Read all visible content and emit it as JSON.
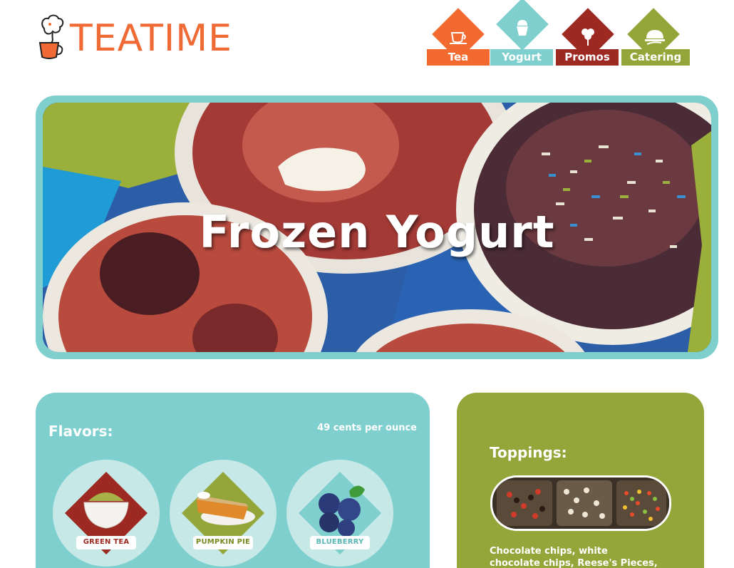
{
  "header": {
    "logo_text": "TEATIME"
  },
  "nav": {
    "items": [
      {
        "label": "Tea",
        "icon": "teacup-icon",
        "color": "#f26a30"
      },
      {
        "label": "Yogurt",
        "icon": "yogurt-cup-icon",
        "color": "#7ecfcd"
      },
      {
        "label": "Promos",
        "icon": "flower-icon",
        "color": "#9c2a22"
      },
      {
        "label": "Catering",
        "icon": "serving-cloche-icon",
        "color": "#94a53a"
      }
    ]
  },
  "hero": {
    "title": "Frozen Yogurt"
  },
  "flavors": {
    "title": "Flavors:",
    "price": "49 cents per ounce",
    "items": [
      {
        "label": "GREEN TEA",
        "color": "#9c2a22"
      },
      {
        "label": "PUMPKIN PIE",
        "color": "#94a53a"
      },
      {
        "label": "BLUEBERRY",
        "color": "#7ecfcd"
      }
    ]
  },
  "toppings": {
    "title": "Toppings:",
    "description": "Chocolate chips, white chocolate chips, Reese's Pieces, Sunflower"
  },
  "colors": {
    "brand_orange": "#ef6a34",
    "teal": "#7ecfcd",
    "olive": "#94a53a",
    "maroon": "#9c2a22"
  }
}
